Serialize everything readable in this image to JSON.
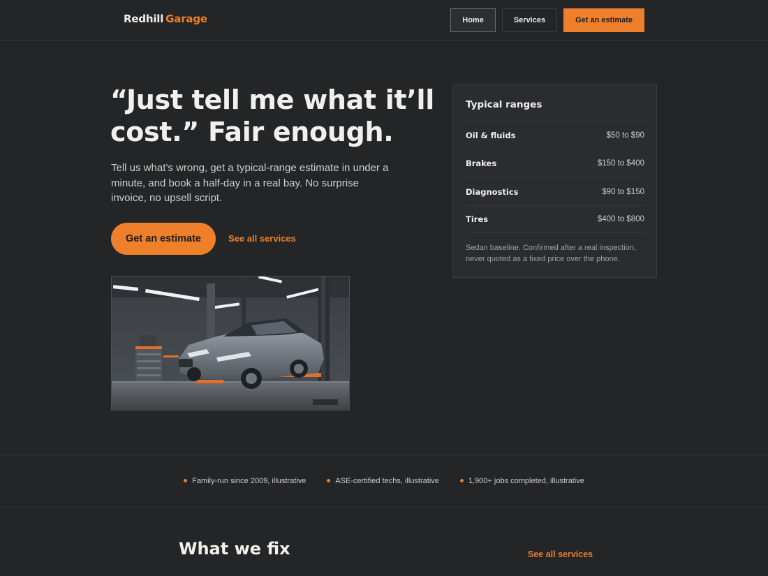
{
  "brand": {
    "name": "Redhill",
    "accent": "Garage"
  },
  "nav": {
    "home": "Home",
    "services": "Services",
    "estimate": "Get an estimate"
  },
  "hero": {
    "title_line1": "“Just tell me what it’ll",
    "title_line2": "cost.” Fair enough.",
    "subtitle": "Tell us what’s wrong, get a typical-range estimate in under a minute, and book a half-day in a real bay. No surprise invoice, no upsell script.",
    "cta": "Get an estimate",
    "link": "See all services"
  },
  "ranges": {
    "title": "Typical ranges",
    "items": [
      {
        "name": "Oil & fluids",
        "value": "$50 to $90"
      },
      {
        "name": "Brakes",
        "value": "$150 to $400"
      },
      {
        "name": "Diagnostics",
        "value": "$90 to $150"
      },
      {
        "name": "Tires",
        "value": "$400 to $800"
      }
    ],
    "note": "Sedan baseline. Confirmed after a real inspection, never quoted as a fixed price over the phone."
  },
  "trust": [
    "Family-run since 2009, illustrative",
    "ASE-certified techs, illustrative",
    "1,900+ jobs completed, illustrative"
  ],
  "section": {
    "title": "What we fix",
    "link": "See all services"
  },
  "colors": {
    "accent": "#ee7f2b",
    "background": "#232527",
    "card": "#2a2c2f"
  },
  "icons": {
    "bullet": "dot-icon"
  }
}
